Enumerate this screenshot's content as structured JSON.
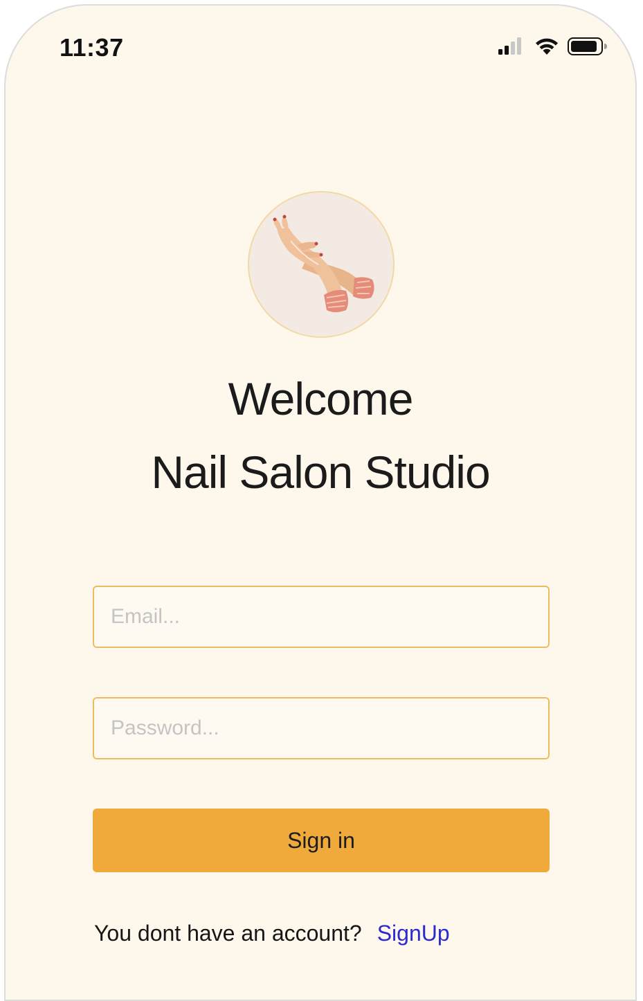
{
  "status_bar": {
    "time": "11:37",
    "icons": [
      "cellular-signal-icon",
      "wifi-icon",
      "battery-icon"
    ]
  },
  "logo": {
    "icon": "hands-illustration-icon"
  },
  "heading": {
    "line1": "Welcome",
    "line2": "Nail Salon Studio"
  },
  "form": {
    "email_placeholder": "Email...",
    "email_value": "",
    "password_placeholder": "Password...",
    "password_value": "",
    "signin_label": "Sign in"
  },
  "footer": {
    "prompt": "You dont have an account?",
    "signup_label": "SignUp"
  },
  "colors": {
    "background": "#fdf7ec",
    "accent": "#f0aa3c",
    "field_border": "#efbb62",
    "link": "#2a2ad0"
  }
}
